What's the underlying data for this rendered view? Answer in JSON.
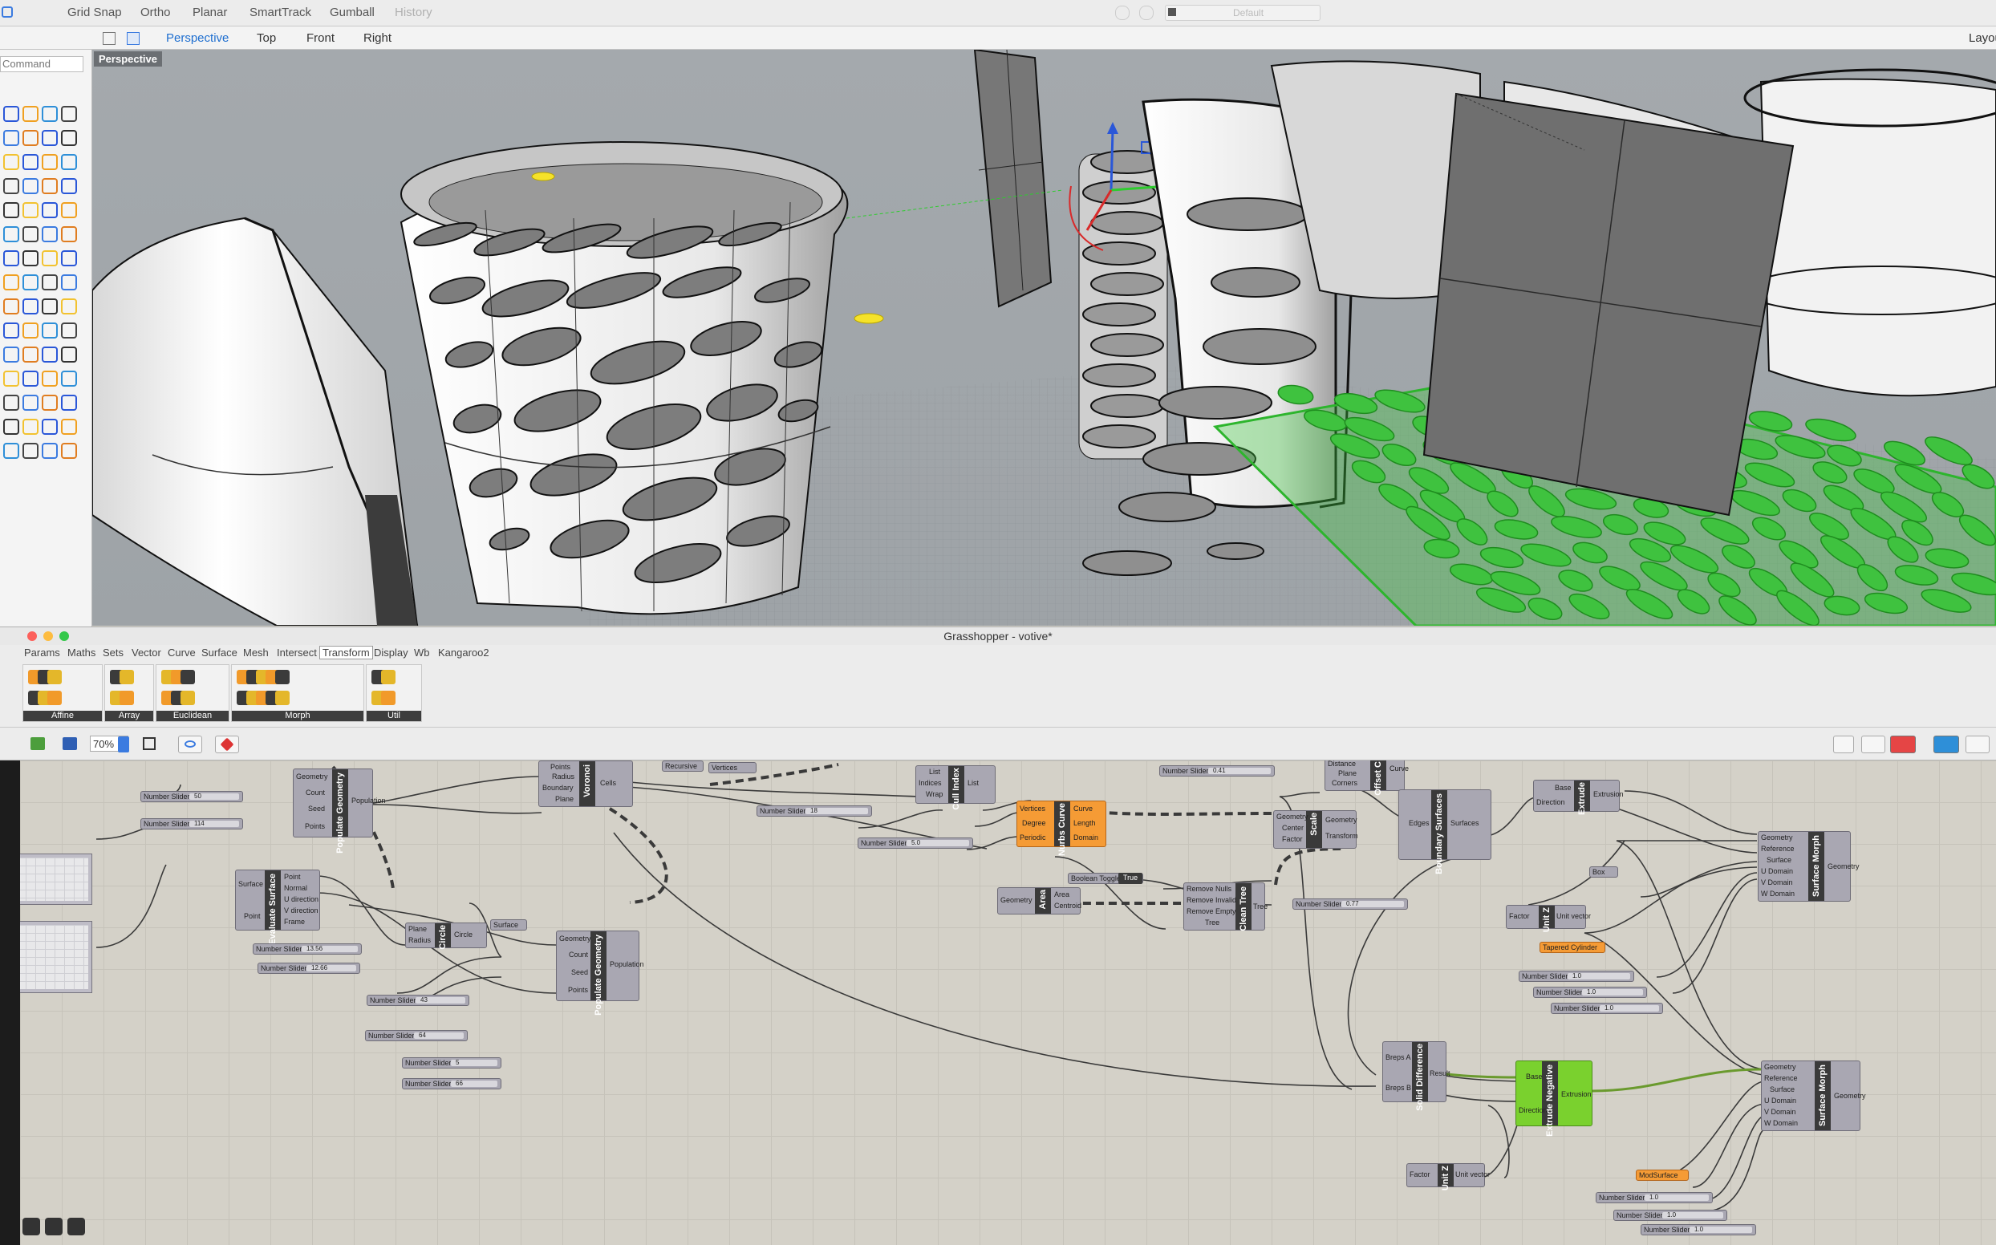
{
  "rhino": {
    "toolbar": {
      "items": [
        "Grid Snap",
        "Ortho",
        "Planar",
        "SmartTrack",
        "Gumball"
      ],
      "history": "History",
      "layer_default": "Default"
    },
    "view_tabs": [
      "Perspective",
      "Top",
      "Front",
      "Right"
    ],
    "layout_label": "Layou",
    "command_placeholder": "Command",
    "viewport_label": "Perspective"
  },
  "grasshopper": {
    "title": "Grasshopper - votive*",
    "tabs": [
      "Params",
      "Maths",
      "Sets",
      "Vector",
      "Curve",
      "Surface",
      "Mesh",
      "Intersect",
      "Transform",
      "Display",
      "Wb",
      "Kangaroo2"
    ],
    "active_tab": "Transform",
    "ribbon_groups": [
      "Affine",
      "Array",
      "Euclidean",
      "Morph",
      "Util"
    ],
    "zoom": "70%",
    "nodes": {
      "populate1": "Populate Geometry",
      "populate2": "Populate Geometry",
      "evaluate": "Evaluate Surface",
      "circle": "Circle",
      "voronoi": "Voronoi",
      "cull_index": "Cull Index",
      "nurbs_curve": "Nurbs Curve",
      "area": "Area",
      "clean_tree": "Clean Tree",
      "scale": "Scale",
      "offset": "Offset C",
      "boundary": "Boundary Surfaces",
      "extrude": "Extrude",
      "unit_z1": "Unit Z",
      "surface_morph1": "Surface Morph",
      "solid_difference": "Solid Difference",
      "extrude_negative": "Extrude Negative",
      "unit_z2": "Unit Z",
      "surface_morph2": "Surface Morph"
    },
    "pins": {
      "populate_in": [
        "Geometry",
        "Count",
        "Seed",
        "Points"
      ],
      "populate_out": "Population",
      "evaluate_in": [
        "Surface",
        "Point"
      ],
      "evaluate_out": [
        "Point",
        "Normal",
        "U direction",
        "V direction",
        "Frame"
      ],
      "circle_in": [
        "Plane",
        "Radius"
      ],
      "circle_out": "Circle",
      "voronoi_in": [
        "Points",
        "Radius",
        "Boundary",
        "Plane"
      ],
      "voronoi_out": "Cells",
      "cull_in": [
        "List",
        "Indices",
        "Wrap"
      ],
      "cull_out": "List",
      "nurbs_in": [
        "Vertices",
        "Degree",
        "Periodic"
      ],
      "nurbs_out": [
        "Curve",
        "Length",
        "Domain"
      ],
      "area_in": "Geometry",
      "area_out": [
        "Area",
        "Centroid"
      ],
      "clean_in": [
        "Remove Nulls",
        "Remove Invalid",
        "Remove Empty",
        "Tree"
      ],
      "clean_out": "Tree",
      "scale_in": [
        "Geometry",
        "Center",
        "Factor"
      ],
      "scale_out": [
        "Geometry",
        "Transform"
      ],
      "offset_in": [
        "Distance",
        "Plane",
        "Corners"
      ],
      "offset_out": "Curve",
      "boundary_in": "Edges",
      "boundary_out": "Surfaces",
      "extrude_in": [
        "Base",
        "Direction"
      ],
      "extrude_out": "Extrusion",
      "unitz_in": "Factor",
      "unitz_out": "Unit vector",
      "morph_in": [
        "Geometry",
        "Reference",
        "Surface",
        "U Domain",
        "V Domain",
        "W Domain"
      ],
      "morph_out": "Geometry",
      "solid_in": [
        "Breps A",
        "Breps B"
      ],
      "solid_out": "Result",
      "extneg_in": [
        "Base",
        "Direction"
      ],
      "extneg_out": "Extrusion"
    },
    "params": {
      "surface": "Surface",
      "box": "Box",
      "tapered_cylinder": "Tapered Cylinder",
      "mod_surface": "ModSurface",
      "boolean_toggle": "Boolean Toggle",
      "boolean_value": "True",
      "recursive": "Recursive",
      "vertices": "Vertices"
    },
    "slider_label": "Number Slider",
    "sliders": [
      {
        "val": "50"
      },
      {
        "val": "114"
      },
      {
        "val": "13.56"
      },
      {
        "val": "12.66"
      },
      {
        "val": "43"
      },
      {
        "val": "64"
      },
      {
        "val": "5"
      },
      {
        "val": "66"
      },
      {
        "val": "18"
      },
      {
        "val": "5.0"
      },
      {
        "val": "0.41"
      },
      {
        "val": "0.77"
      },
      {
        "val": "1.0"
      },
      {
        "val": "1.0"
      },
      {
        "val": "1.0"
      },
      {
        "val": "1.0"
      },
      {
        "val": "1.0"
      },
      {
        "val": "1.0"
      }
    ]
  }
}
